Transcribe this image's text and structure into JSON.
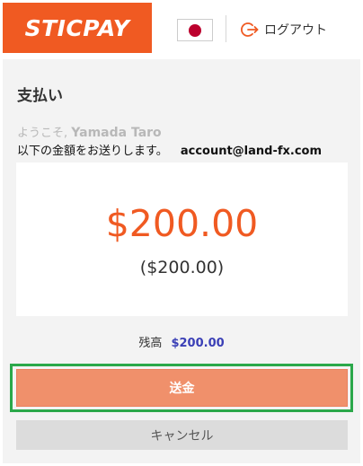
{
  "header": {
    "logo_text": "STICPAY",
    "flag_icon": "japan-flag-icon",
    "logout_icon": "logout-arrow-icon",
    "logout_label": "ログアウト"
  },
  "payment": {
    "title": "支払い",
    "welcome_prefix": "ようこそ,",
    "user_name": "Yamada Taro",
    "send_message": "以下の金額をお送りします。",
    "recipient_account": "account@land-fx.com",
    "amount": "$200.00",
    "amount_sub": "($200.00)",
    "balance_label": "残高",
    "balance_value": "$200.00",
    "send_button": "送金",
    "cancel_button": "キャンセル"
  },
  "colors": {
    "brand": "#f05a22",
    "send_button_bg": "#f0906b",
    "focus_outline": "#2ba84a",
    "balance_value": "#3a3fb6"
  }
}
